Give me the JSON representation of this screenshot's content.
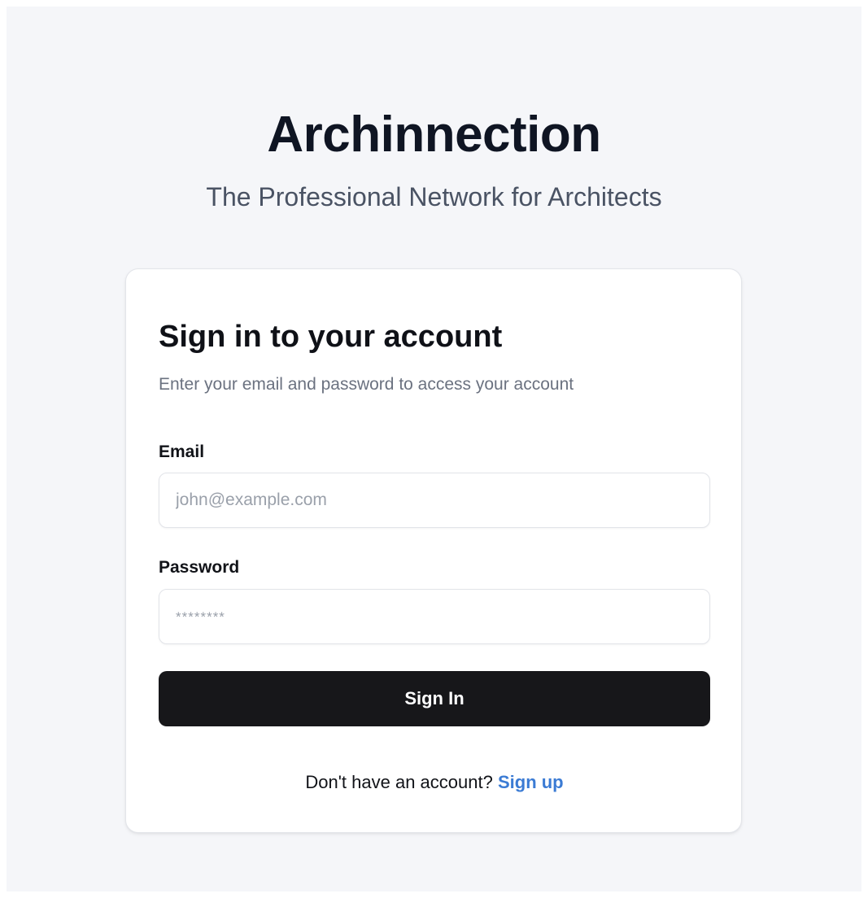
{
  "brand": {
    "title": "Archinnection",
    "tagline": "The Professional Network for Architects"
  },
  "login_card": {
    "title": "Sign in to your account",
    "subtitle": "Enter your email and password to access your account",
    "email": {
      "label": "Email",
      "value": "",
      "placeholder": "john@example.com"
    },
    "password": {
      "label": "Password",
      "value": "",
      "placeholder": "********"
    },
    "submit_label": "Sign In",
    "signup_prompt": "Don't have an account?",
    "signup_link": "Sign up"
  },
  "colors": {
    "page_background": "#f5f6f9",
    "primary_button": "#17171a",
    "link": "#3b7bd4"
  }
}
